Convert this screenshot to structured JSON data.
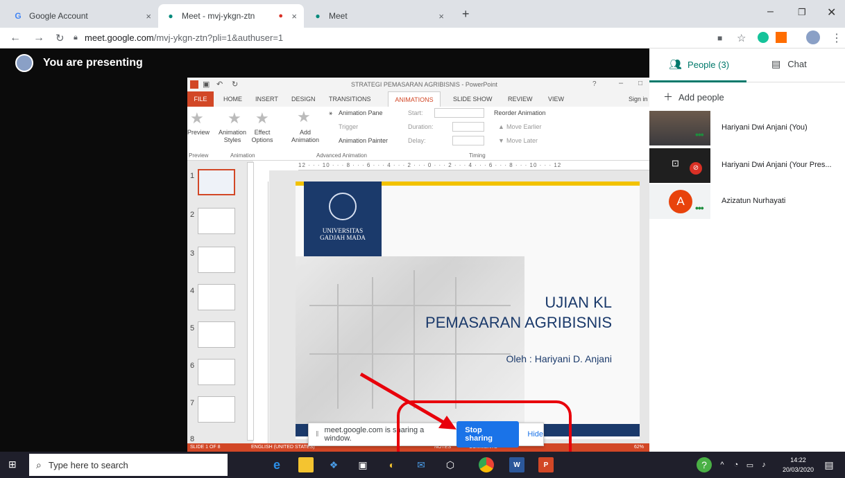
{
  "browser": {
    "tabs": [
      {
        "title": "Google Account",
        "close": "×"
      },
      {
        "title": "Meet - mvj-ykgn-ztn",
        "close": "×",
        "recording": "●"
      },
      {
        "title": "Meet",
        "close": "×"
      }
    ],
    "new_tab": "+",
    "url_host": "meet.google.com",
    "url_path": "/mvj-ykgn-ztn?pli=1&authuser=1"
  },
  "meet": {
    "presenting_label": "You are presenting",
    "people_tab": "People (3)",
    "chat_tab": "Chat",
    "add_people": "Add people",
    "participants": [
      {
        "name": "Hariyani Dwi Anjani (You)"
      },
      {
        "name": "Hariyani Dwi Anjani (Your Pres..."
      },
      {
        "name": "Azizatun Nurhayati",
        "initial": "A"
      }
    ],
    "share_msg": "meet.google.com is sharing a window.",
    "stop_sharing": "Stop sharing",
    "hide": "Hide"
  },
  "ppt": {
    "window_title": "STRATEGI PEMASARAN AGRIBISNIS - PowerPoint",
    "sign_in": "Sign in",
    "ribbon_tabs": [
      "FILE",
      "HOME",
      "INSERT",
      "DESIGN",
      "TRANSITIONS",
      "ANIMATIONS",
      "SLIDE SHOW",
      "REVIEW",
      "VIEW"
    ],
    "preview": "Preview",
    "animation_styles": "Animation Styles",
    "effect_options": "Effect Options",
    "add_animation": "Add Animation",
    "animation_pane": "Animation Pane",
    "trigger": "Trigger",
    "animation_painter": "Animation Painter",
    "start": "Start:",
    "duration": "Duration:",
    "delay": "Delay:",
    "reorder": "Reorder Animation",
    "move_earlier": "Move Earlier",
    "move_later": "Move Later",
    "grp_preview": "Preview",
    "grp_animation": "Animation",
    "grp_advanced": "Advanced Animation",
    "grp_timing": "Timing",
    "ruler": "12 · · · 10 · · · 8 · · · 6 · · · 4 · · · 2 · · · 0 · · · 2 · · · 4 · · · 6 · · · 8 · · · 10 · · · 12",
    "thumb_numbers": [
      "1",
      "2",
      "3",
      "4",
      "5",
      "6",
      "7",
      "8"
    ],
    "slide": {
      "logo_line1": "UNIVERSITAS",
      "logo_line2": "GADJAH MADA",
      "title_line1": "UJIAN KL",
      "title_line2": "PEMASARAN AGRIBISNIS",
      "subtitle": "Oleh : Hariyani D. Anjani"
    },
    "status_slide": "SLIDE 1 OF 8",
    "status_lang": "ENGLISH (UNITED STATES)",
    "status_notes": "NOTES",
    "status_comments": "COMMENTS",
    "zoom": "62%"
  },
  "taskbar": {
    "search_placeholder": "Type here to search",
    "time": "14:22",
    "date": "20/03/2020"
  }
}
